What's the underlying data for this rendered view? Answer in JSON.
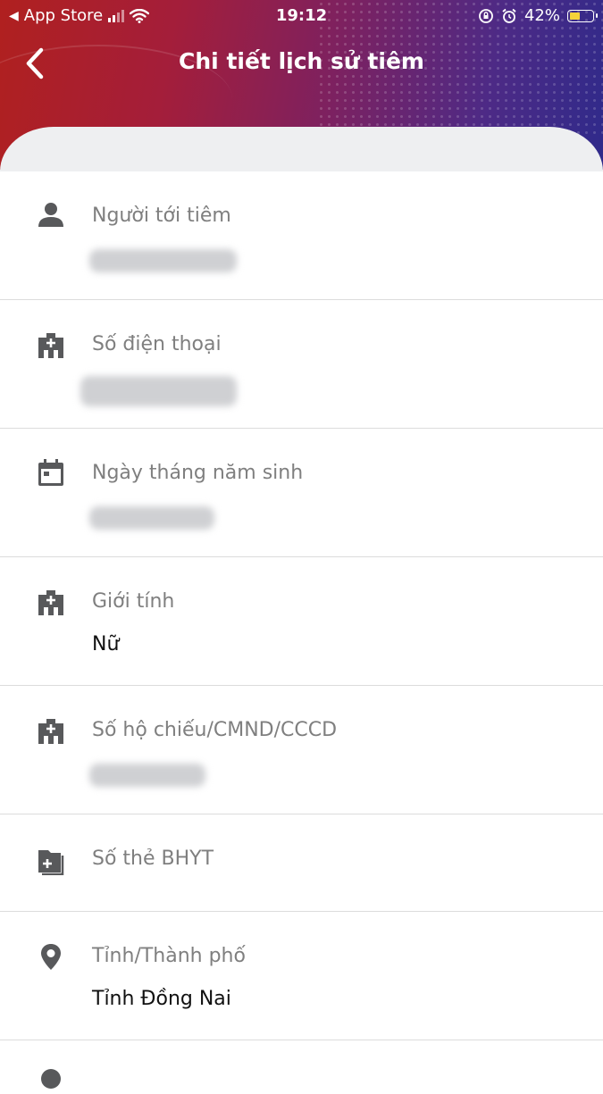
{
  "status_bar": {
    "back_app": "App Store",
    "time": "19:12",
    "battery": "42%"
  },
  "nav": {
    "title": "Chi tiết lịch sử tiêm"
  },
  "fields": [
    {
      "label": "Người tới tiêm",
      "value": "",
      "icon": "person-icon"
    },
    {
      "label": "Số điện thoại",
      "value": "",
      "icon": "hospital-icon"
    },
    {
      "label": "Ngày tháng năm sinh",
      "value": "",
      "icon": "calendar-icon"
    },
    {
      "label": "Giới tính",
      "value": "Nữ",
      "icon": "hospital-icon"
    },
    {
      "label": "Số hộ chiếu/CMND/CCCD",
      "value": "",
      "icon": "hospital-icon"
    },
    {
      "label": "Số thẻ BHYT",
      "value": "",
      "icon": "insurance-card-icon"
    },
    {
      "label": "Tỉnh/Thành phố",
      "value": "Tỉnh Đồng Nai",
      "icon": "location-pin-icon"
    }
  ],
  "colors": {
    "header_start": "#b0201f",
    "header_end": "#2f2a8a",
    "label": "#7f7f7f",
    "value": "#111111",
    "icon": "#58595b"
  }
}
